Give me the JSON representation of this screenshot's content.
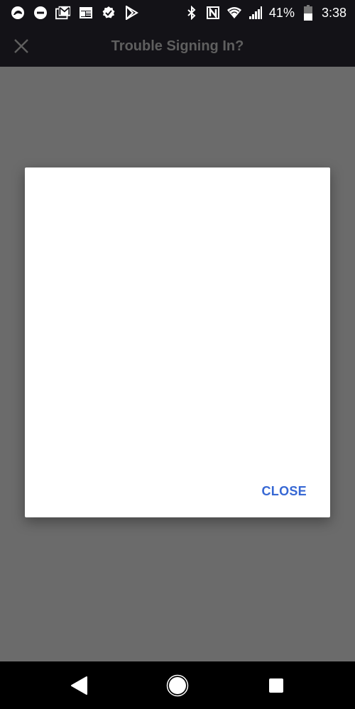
{
  "status_bar": {
    "left_icons": [
      "ring-app-icon",
      "do-not-disturb-icon",
      "gmail-icon",
      "calendar-icon",
      "verified-badge-icon",
      "play-store-icon"
    ],
    "right_icons": [
      "bluetooth-icon",
      "nfc-icon",
      "wifi-icon",
      "cell-signal-icon",
      "battery-icon"
    ],
    "battery_percent": "41%",
    "battery_level": 0.41,
    "time": "3:38"
  },
  "app_bar": {
    "title": "Trouble Signing In?",
    "close_icon": "close-icon"
  },
  "dialog": {
    "close_label": "CLOSE",
    "accent_color": "#3768d4"
  },
  "nav_bar": {
    "buttons": [
      "back",
      "home",
      "recents"
    ]
  },
  "colors": {
    "status_bar_bg": "#131217",
    "scrim": "#6b6b6b",
    "title_text": "#5f5f5f"
  }
}
